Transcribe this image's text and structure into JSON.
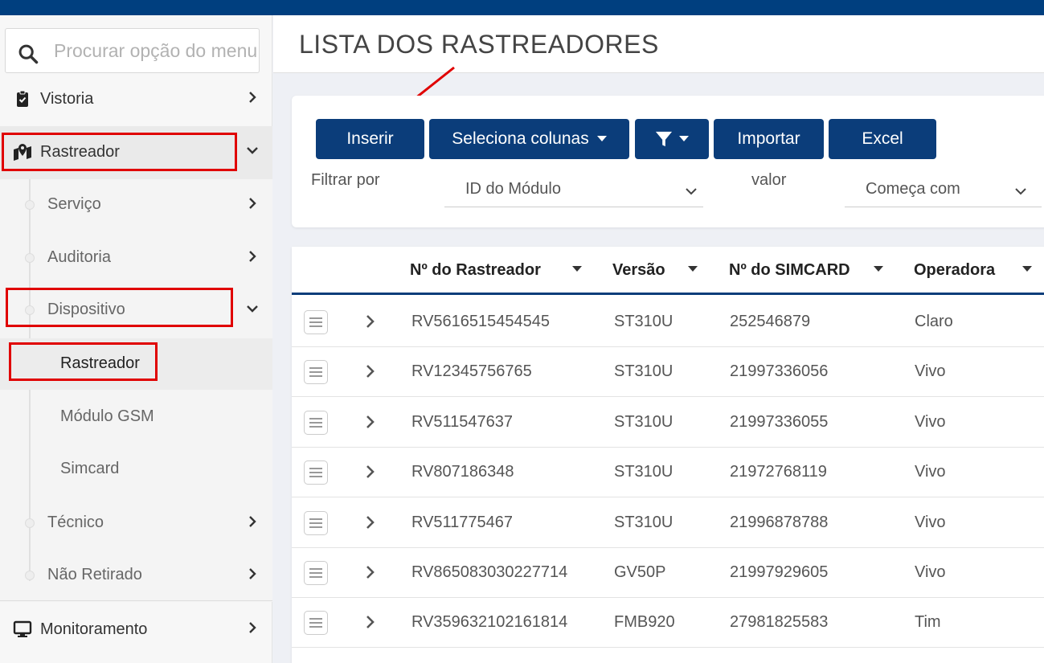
{
  "search": {
    "placeholder": "Procurar opção do menu"
  },
  "sidebar": {
    "vistoria": "Vistoria",
    "rastreador": "Rastreador",
    "sub": {
      "servico": "Serviço",
      "auditoria": "Auditoria",
      "dispositivo": "Dispositivo",
      "tecnico": "Técnico",
      "nao_retirado": "Não Retirado"
    },
    "dispositivo_items": {
      "rastreador": "Rastreador",
      "modulo_gsm": "Módulo GSM",
      "simcard": "Simcard"
    },
    "monitoramento": "Monitoramento"
  },
  "page": {
    "title": "LISTA DOS RASTREADORES"
  },
  "toolbar": {
    "inserir": "Inserir",
    "seleciona_colunas": "Seleciona colunas",
    "importar": "Importar",
    "excel": "Excel"
  },
  "filter": {
    "filtrar_por_label": "Filtrar por",
    "field_value": "ID do Módulo",
    "valor_label": "valor",
    "operator_value": "Começa com"
  },
  "table": {
    "headers": {
      "rastreador": "Nº do Rastreador",
      "versao": "Versão",
      "simcard": "Nº do SIMCARD",
      "operadora": "Operadora"
    },
    "rows": [
      {
        "rastreador": "RV5616515454545",
        "versao": "ST310U",
        "simcard": "252546879",
        "operadora": "Claro"
      },
      {
        "rastreador": "RV12345756765",
        "versao": "ST310U",
        "simcard": "21997336056",
        "operadora": "Vivo"
      },
      {
        "rastreador": "RV511547637",
        "versao": "ST310U",
        "simcard": "21997336055",
        "operadora": "Vivo"
      },
      {
        "rastreador": "RV807186348",
        "versao": "ST310U",
        "simcard": "21972768119",
        "operadora": "Vivo"
      },
      {
        "rastreador": "RV511775467",
        "versao": "ST310U",
        "simcard": "21996878788",
        "operadora": "Vivo"
      },
      {
        "rastreador": "RV865083030227714",
        "versao": "GV50P",
        "simcard": "21997929605",
        "operadora": "Vivo"
      },
      {
        "rastreador": "RV359632102161814",
        "versao": "FMB920",
        "simcard": "27981825583",
        "operadora": "Tim"
      }
    ]
  },
  "colors": {
    "primary": "#0b3d7a",
    "topbar": "#003f7f",
    "annotation": "#e00000"
  }
}
